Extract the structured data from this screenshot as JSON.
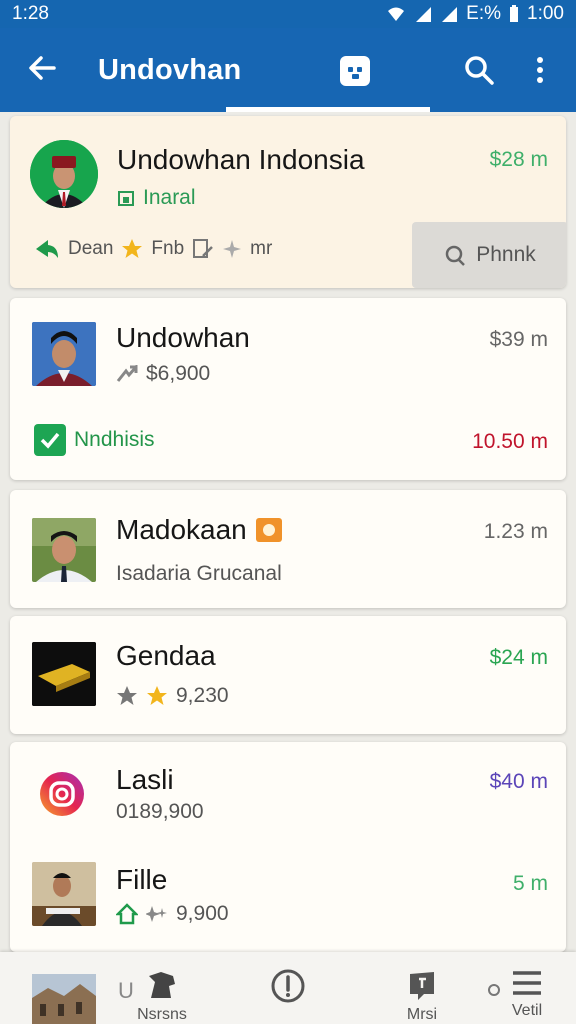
{
  "status_bar": {
    "time": "1:28",
    "battery_text": "E:%",
    "clock": "1:00"
  },
  "app_bar": {
    "title": "Undovhan"
  },
  "cards": [
    {
      "name": "Undowhan Indonsia",
      "subtitle": "Inaral",
      "amount": "$28 m",
      "amount_color": "#3faf6a",
      "actions": [
        "Dean",
        "Fnb",
        "mr"
      ],
      "call_label": "Phnnk"
    },
    {
      "name": "Undowhan",
      "subtitle": "$6,900",
      "amount": "$39 m",
      "amount_color": "#666666",
      "tag": "Nndhisis",
      "tag_amount": "10.50 m",
      "tag_amount_color": "#c0142c"
    },
    {
      "name": "Madokaan",
      "subtitle": "Isadaria Grucanal",
      "amount": "1.23 m",
      "amount_color": "#666666"
    },
    {
      "name": "Gendaa",
      "subtitle": "9,230",
      "amount": "$24 m",
      "amount_color": "#2aa552"
    },
    {
      "name": "Lasli",
      "subtitle": "0189,900",
      "amount": "$40 m",
      "amount_color": "#5b45b8"
    },
    {
      "name": "Fille",
      "subtitle": "9,900",
      "amount": "5 m",
      "amount_color": "#3faf6a"
    }
  ],
  "bottom_nav": {
    "items": [
      "Nsrsns",
      "",
      "Mrsi",
      "Vetil"
    ],
    "partial_letter": "U"
  }
}
